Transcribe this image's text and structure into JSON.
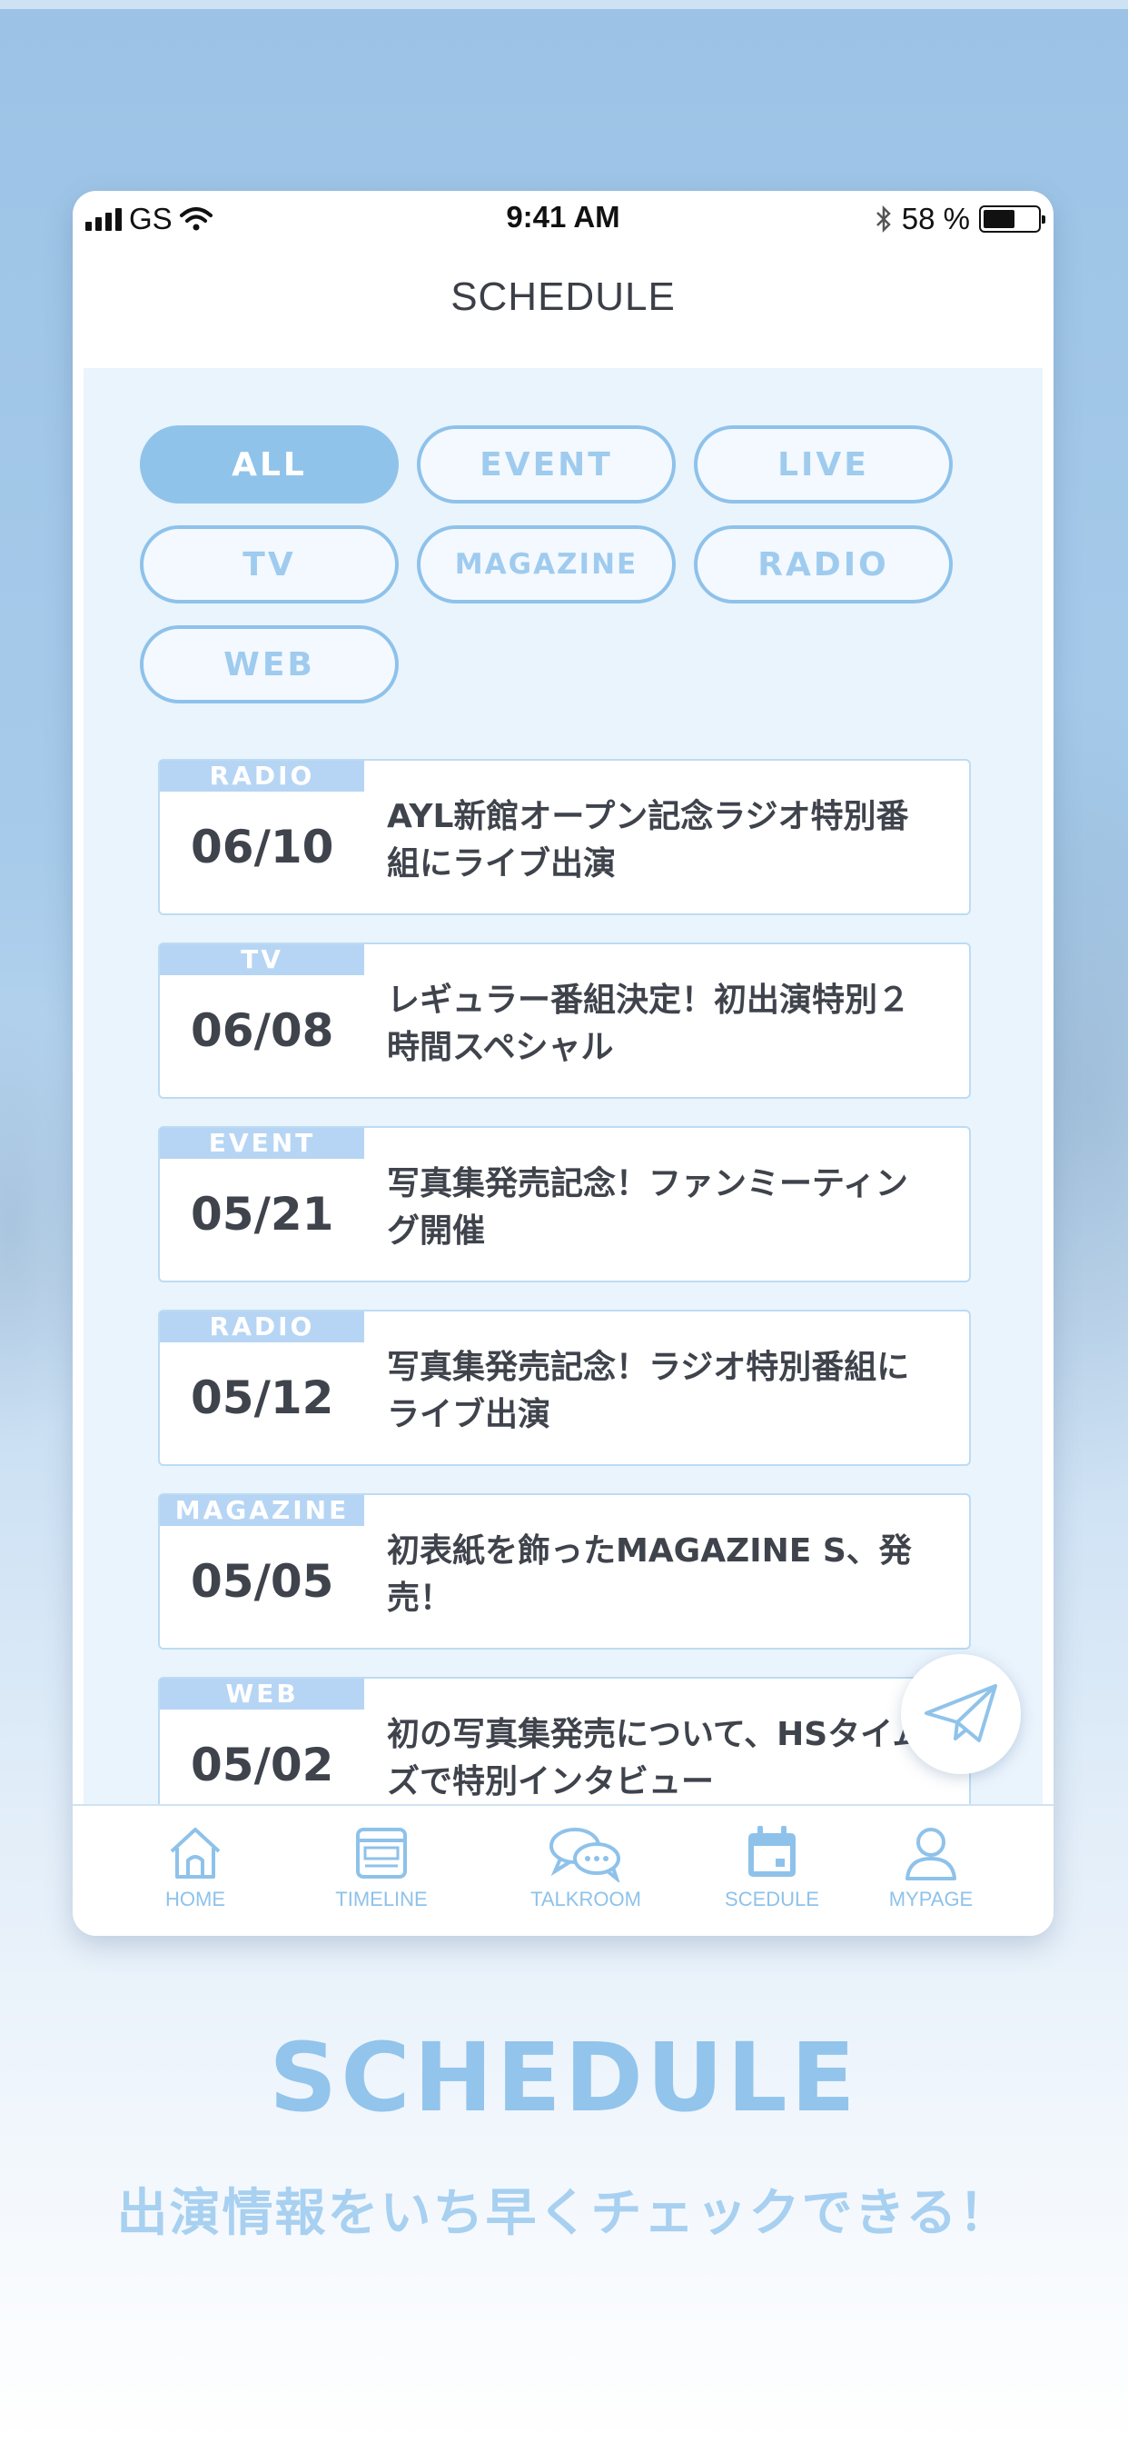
{
  "status_bar": {
    "carrier": "GS",
    "time": "9:41 AM",
    "battery": "58 %",
    "battery_level": 0.58
  },
  "header": {
    "title": "SCHEDULE"
  },
  "filters": [
    {
      "label": "ALL",
      "active": true
    },
    {
      "label": "EVENT",
      "active": false
    },
    {
      "label": "LIVE",
      "active": false
    },
    {
      "label": "TV",
      "active": false
    },
    {
      "label": "MAGAZINE",
      "active": false
    },
    {
      "label": "RADIO",
      "active": false
    },
    {
      "label": "WEB",
      "active": false
    }
  ],
  "schedule": [
    {
      "category": "RADIO",
      "date": "06/10",
      "title": "AYL新館オープン記念ラジオ特別番組にライブ出演"
    },
    {
      "category": "TV",
      "date": "06/08",
      "title": "レギュラー番組決定！初出演特別２時間スペシャル"
    },
    {
      "category": "EVENT",
      "date": "05/21",
      "title": "写真集発売記念！ファンミーティング開催"
    },
    {
      "category": "RADIO",
      "date": "05/12",
      "title": "写真集発売記念！ラジオ特別番組にライブ出演"
    },
    {
      "category": "MAGAZINE",
      "date": "05/05",
      "title": "初表紙を飾ったMAGAZINE S、発売！"
    },
    {
      "category": "WEB",
      "date": "05/02",
      "title": "初の写真集発売について、HSタイムズで特別インタビュー"
    }
  ],
  "tabbar": [
    {
      "label": "HOME",
      "icon": "home-icon"
    },
    {
      "label": "TIMELINE",
      "icon": "timeline-icon"
    },
    {
      "label": "TALKROOM",
      "icon": "chat-bubbles-icon"
    },
    {
      "label": "SCEDULE",
      "icon": "calendar-icon"
    },
    {
      "label": "MYPAGE",
      "icon": "person-icon"
    }
  ],
  "caption": {
    "title": "SCHEDULE",
    "subtitle": "出演情報をいち早くチェックできる！"
  },
  "colors": {
    "accent": "#90c3ea",
    "badge": "#b6d5f4",
    "text": "#3f434c",
    "panel": "#eaf4fd"
  }
}
